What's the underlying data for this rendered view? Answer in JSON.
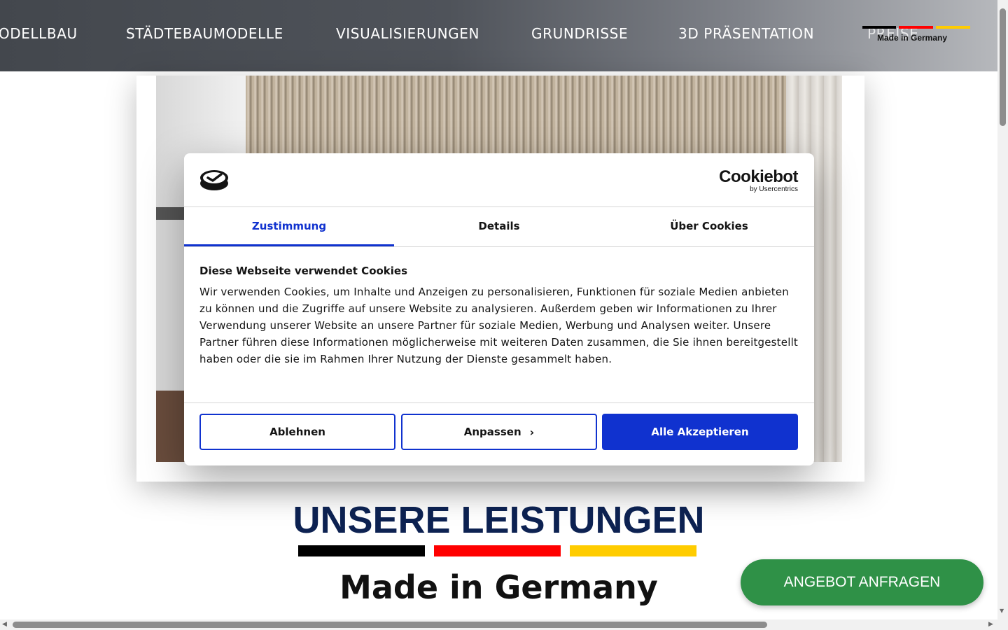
{
  "nav": {
    "items": [
      "MODELLBAU",
      "STÄDTEBAUMODELLE",
      "VISUALISIERUNGEN",
      "GRUNDRISSE",
      "3D PRÄSENTATION",
      "PREISE"
    ],
    "badge_label": "Made in Germany"
  },
  "cookie": {
    "brand_main": "Cookiebot",
    "brand_sub": "by Usercentrics",
    "tabs": [
      "Zustimmung",
      "Details",
      "Über Cookies"
    ],
    "active_tab": "Zustimmung",
    "title": "Diese Webseite verwendet Cookies",
    "text": "Wir verwenden Cookies, um Inhalte und Anzeigen zu personalisieren, Funktionen für soziale Medien anbieten zu können und die Zugriffe auf unsere Website zu analysieren. Außerdem geben wir Informationen zu Ihrer Verwendung unserer Website an unsere Partner für soziale Medien, Werbung und Analysen weiter. Unsere Partner führen diese Informationen möglicherweise mit weiteren Daten zusammen, die Sie ihnen bereitgestellt haben oder die sie im Rahmen Ihrer Nutzung der Dienste gesammelt haben.",
    "buttons": {
      "decline": "Ablehnen",
      "customize": "Anpassen",
      "accept_all": "Alle Akzeptieren"
    },
    "accent_color": "#1032cf"
  },
  "section": {
    "title": "UNSERE LEISTUNGEN",
    "subtitle": "Made in Germany"
  },
  "cta": {
    "label": "ANGEBOT ANFRAGEN",
    "color": "#2f9147"
  },
  "flag_colors": [
    "#000000",
    "#ff0000",
    "#ffcc00"
  ]
}
